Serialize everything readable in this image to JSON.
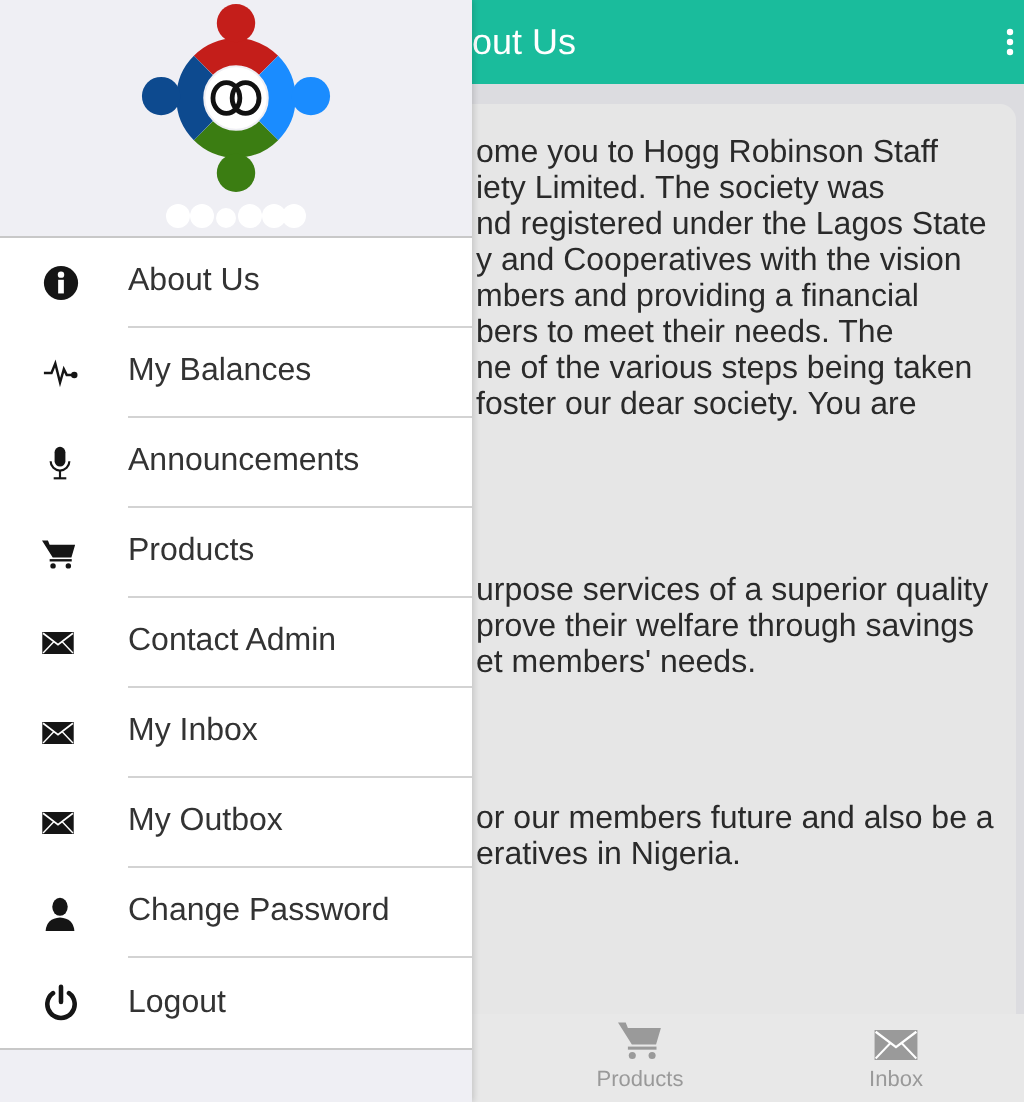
{
  "drawer": {
    "menu": [
      {
        "label": "About Us",
        "kind": "info"
      },
      {
        "label": "My Balances",
        "kind": "pulse"
      },
      {
        "label": "Announcements",
        "kind": "microphone"
      },
      {
        "label": "Products",
        "kind": "cart"
      },
      {
        "label": "Contact Admin",
        "kind": "envelope"
      },
      {
        "label": "My Inbox",
        "kind": "envelope"
      },
      {
        "label": "My Outbox",
        "kind": "envelope"
      },
      {
        "label": "Change Password",
        "kind": "person"
      },
      {
        "label": "Logout",
        "kind": "power"
      }
    ]
  },
  "app_bar": {
    "title": "out Us"
  },
  "content": {
    "paragraphs": [
      {
        "lines": [
          "ome you to Hogg Robinson Staff",
          "iety Limited. The society was",
          "nd registered under the Lagos State",
          "y and Cooperatives with the vision",
          "mbers and providing a financial",
          "bers to meet their needs. The",
          "ne of the various steps being taken",
          "foster our dear society. You are"
        ]
      },
      {
        "lines": [
          "urpose services of a superior quality",
          "prove their welfare through savings",
          "et members' needs."
        ]
      },
      {
        "lines": [
          "or our members future and also be a",
          "eratives in Nigeria."
        ]
      }
    ]
  },
  "bottom_nav": [
    {
      "label": "Products",
      "kind": "cart"
    },
    {
      "label": "Inbox",
      "kind": "envelope"
    }
  ]
}
